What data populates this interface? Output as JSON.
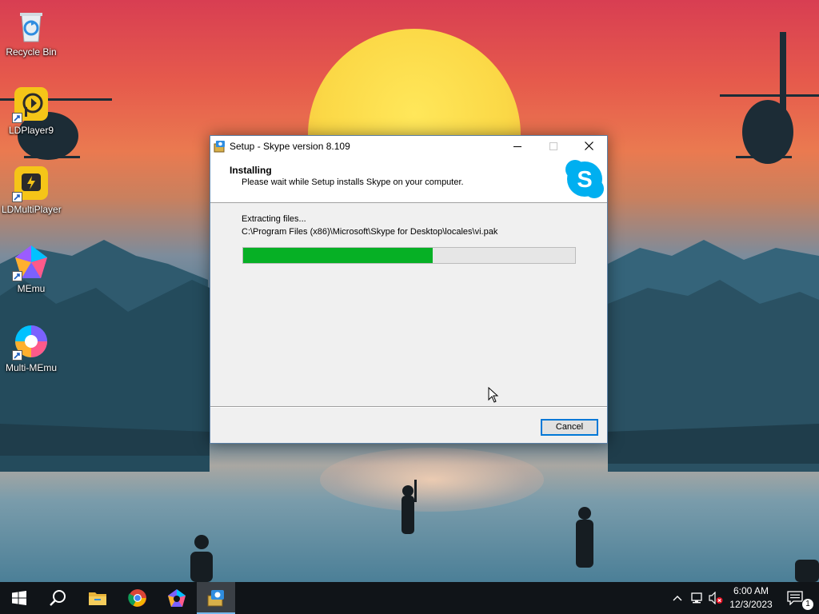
{
  "desktop": {
    "icons": [
      {
        "label": "Recycle Bin",
        "icon": "recycle-bin-icon"
      },
      {
        "label": "LDPlayer9",
        "icon": "ldplayer-icon"
      },
      {
        "label": "LDMultiPlayer",
        "icon": "ldmultiplayer-icon"
      },
      {
        "label": "MEmu",
        "icon": "memu-icon"
      },
      {
        "label": "Multi-MEmu",
        "icon": "multi-memu-icon"
      }
    ]
  },
  "dialog": {
    "title": "Setup - Skype version 8.109",
    "header_title": "Installing",
    "header_subtitle": "Please wait while Setup installs Skype on your computer.",
    "status_text": "Extracting files...",
    "file_path": "C:\\Program Files (x86)\\Microsoft\\Skype for Desktop\\locales\\vi.pak",
    "progress": 0.57,
    "cancel_label": "Cancel",
    "colors": {
      "progress_fill": "#06b025",
      "accent": "#0078d7",
      "skype_blue": "#00aff0"
    }
  },
  "taskbar": {
    "items": [
      {
        "icon": "windows-start-icon"
      },
      {
        "icon": "search-icon"
      },
      {
        "icon": "file-explorer-icon"
      },
      {
        "icon": "chrome-icon"
      },
      {
        "icon": "memu-taskbar-icon"
      },
      {
        "icon": "skype-setup-icon",
        "active": true
      }
    ],
    "tray": {
      "icons": [
        "chevron-up-icon",
        "network-icon",
        "volume-muted-icon"
      ]
    },
    "clock": {
      "time": "6:00 AM",
      "date": "12/3/2023"
    },
    "notifications": {
      "count": "1"
    }
  }
}
